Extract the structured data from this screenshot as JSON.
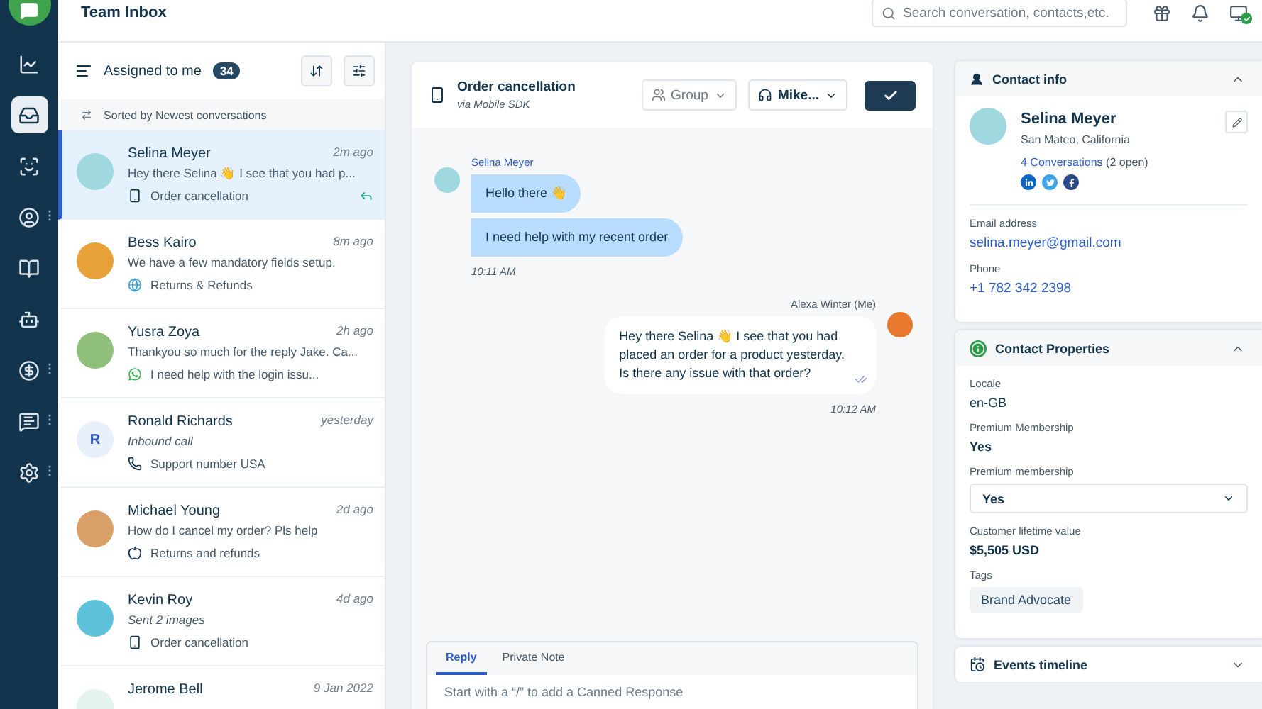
{
  "nav": {
    "items": [
      {
        "selected": false,
        "menu": false
      },
      {
        "selected": true,
        "menu": false
      },
      {
        "selected": false,
        "menu": false
      },
      {
        "selected": false,
        "menu": true
      },
      {
        "selected": false,
        "menu": false
      },
      {
        "selected": false,
        "menu": false
      },
      {
        "selected": false,
        "menu": true
      },
      {
        "selected": false,
        "menu": true
      },
      {
        "selected": false,
        "menu": true
      }
    ]
  },
  "header": {
    "title": "Team Inbox",
    "search": {
      "placeholder": "Search conversation, contacts,etc."
    }
  },
  "inbox": {
    "filter": "Assigned to me",
    "count": "34",
    "sort_label": "Sorted by Newest conversations",
    "conversations": [
      {
        "name": "Selina Meyer",
        "time": "2m ago",
        "preview": "Hey there Selina 👋 I see that you had p...",
        "preview_italic": false,
        "channel": {
          "kind": "mobile",
          "label": "Order cancellation"
        },
        "avatar": {
          "kind": "photo",
          "color": "#9fd8df"
        },
        "selected": true,
        "replied": true
      },
      {
        "name": "Bess Kairo",
        "time": "8m ago",
        "preview": "We have a few mandatory fields setup.",
        "preview_italic": false,
        "channel": {
          "kind": "globe",
          "label": "Returns & Refunds"
        },
        "avatar": {
          "kind": "photo",
          "color": "#e8a23a"
        },
        "selected": false,
        "replied": false
      },
      {
        "name": "Yusra Zoya",
        "time": "2h ago",
        "preview": "Thankyou so much for the reply Jake. Ca...",
        "preview_italic": false,
        "channel": {
          "kind": "whatsapp",
          "label": "I need help with the login issu..."
        },
        "avatar": {
          "kind": "photo",
          "color": "#8fbf7a"
        },
        "selected": false,
        "replied": false
      },
      {
        "name": "Ronald Richards",
        "time": "yesterday",
        "preview": "Inbound call",
        "preview_italic": true,
        "channel": {
          "kind": "phone",
          "label": "Support number USA"
        },
        "avatar": {
          "kind": "initial",
          "initial": "R",
          "color": "#e7f0fb"
        },
        "selected": false,
        "replied": false
      },
      {
        "name": "Michael Young",
        "time": "2d ago",
        "preview": "How do I cancel my order? Pls help",
        "preview_italic": false,
        "channel": {
          "kind": "apple",
          "label": "Returns and refunds"
        },
        "avatar": {
          "kind": "photo",
          "color": "#d9a06a"
        },
        "selected": false,
        "replied": false
      },
      {
        "name": "Kevin Roy",
        "time": "4d ago",
        "preview": "Sent 2 images",
        "preview_italic": true,
        "channel": {
          "kind": "mobile",
          "label": "Order cancellation"
        },
        "avatar": {
          "kind": "photo",
          "color": "#5ec3d8"
        },
        "selected": false,
        "replied": false
      },
      {
        "name": "Jerome Bell",
        "time": "9 Jan 2022",
        "avatar": {
          "kind": "initial",
          "color": "#e3f4ee"
        },
        "selected": false,
        "replied": false
      }
    ]
  },
  "conversation": {
    "title": "Order cancellation",
    "subtitle": "via Mobile SDK",
    "group": "Group",
    "agent": "Mike...",
    "messages": [
      {
        "kind": "incoming",
        "sender": "Selina Meyer",
        "bubbles": [
          [
            "Hello there 👋"
          ],
          [
            "I need help with my recent order"
          ]
        ],
        "time": "10:11 AM"
      },
      {
        "kind": "outgoing",
        "sender": "Alexa Winter (Me)",
        "bubbles": [
          [
            "Hey there Selina 👋 I see that you had",
            "placed an order for a product yesterday.",
            "Is there any issue with that order?"
          ]
        ],
        "time": "10:12 AM",
        "read": true
      }
    ],
    "composer": {
      "tabs": [
        {
          "label": "Reply",
          "selected": true
        },
        {
          "label": "Private Note",
          "selected": false
        }
      ],
      "placeholder": "Start with a “/” to add a Canned Response"
    }
  },
  "contact_info": {
    "title": "Contact info",
    "expanded": true,
    "name": "Selina Meyer",
    "location": "San Mateo, California",
    "conversations_link": "4 Conversations",
    "conversations_open": "(2 open)",
    "social": [
      {
        "kind": "linkedin"
      },
      {
        "kind": "twitter"
      },
      {
        "kind": "facebook"
      }
    ],
    "fields": [
      {
        "label": "Email address",
        "value": "selina.meyer@gmail.com"
      },
      {
        "label": "Phone",
        "value": "+1 782 342 2398"
      }
    ]
  },
  "contact_properties": {
    "title": "Contact Properties",
    "expanded": true,
    "fields": [
      {
        "kind": "text",
        "label": "Locale",
        "value": "en-GB",
        "bold": false
      },
      {
        "kind": "text",
        "label": "Premium Membership",
        "value": "Yes",
        "bold": true
      },
      {
        "kind": "select",
        "label": "Premium membership",
        "value": "Yes"
      },
      {
        "kind": "text",
        "label": "Customer lifetime value",
        "value": "$5,505 USD",
        "bold": true
      },
      {
        "kind": "tags",
        "label": "Tags",
        "tags": [
          "Brand Advocate"
        ]
      }
    ]
  },
  "events_timeline": {
    "title": "Events timeline",
    "expanded": false
  }
}
